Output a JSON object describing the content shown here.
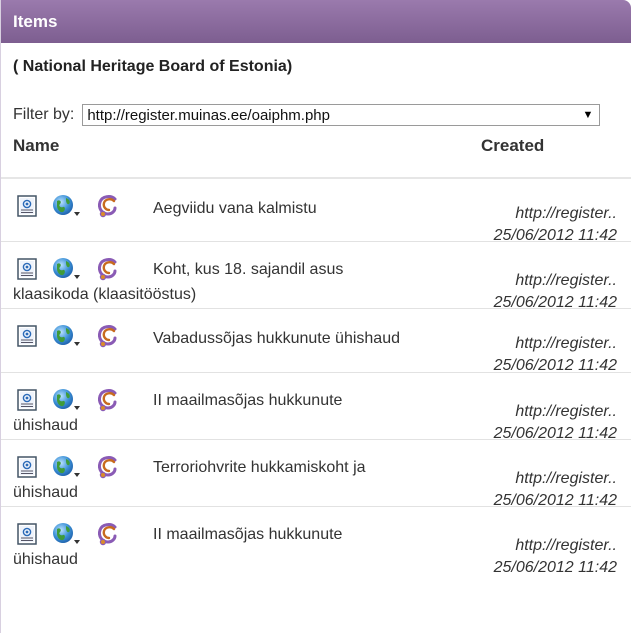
{
  "panel": {
    "title": "Items",
    "subtitle": "( National Heritage Board of Estonia)",
    "filter_label": "Filter by:",
    "filter_value": "http://register.muinas.ee/oaiphm.php",
    "columns": {
      "name": "Name",
      "created": "Created"
    }
  },
  "rows": [
    {
      "title_line1": "Aegviidu vana kalmistu",
      "title_line2": "",
      "source": "http://register..",
      "date": "25/06/2012 11:42"
    },
    {
      "title_line1": "Koht, kus 18. sajandil asus",
      "title_line2": "klaasikoda (klaasitööstus)",
      "source": "http://register..",
      "date": "25/06/2012 11:42"
    },
    {
      "title_line1": "Vabadussõjas hukkunute ühishaud",
      "title_line2": "",
      "source": "http://register..",
      "date": "25/06/2012 11:42"
    },
    {
      "title_line1": "II maailmasõjas hukkunute",
      "title_line2": "ühishaud",
      "source": "http://register..",
      "date": "25/06/2012 11:42"
    },
    {
      "title_line1": "Terroriohvrite hukkamiskoht ja",
      "title_line2": "ühishaud",
      "source": "http://register..",
      "date": "25/06/2012 11:42"
    },
    {
      "title_line1": "II maailmasõjas hukkunute",
      "title_line2": "ühishaud",
      "source": "http://register..",
      "date": "25/06/2012 11:42"
    }
  ],
  "icons": {
    "document": "document-icon",
    "globe": "globe-menu-icon",
    "record": "record-icon"
  },
  "colors": {
    "header": "#8a6a9c"
  }
}
